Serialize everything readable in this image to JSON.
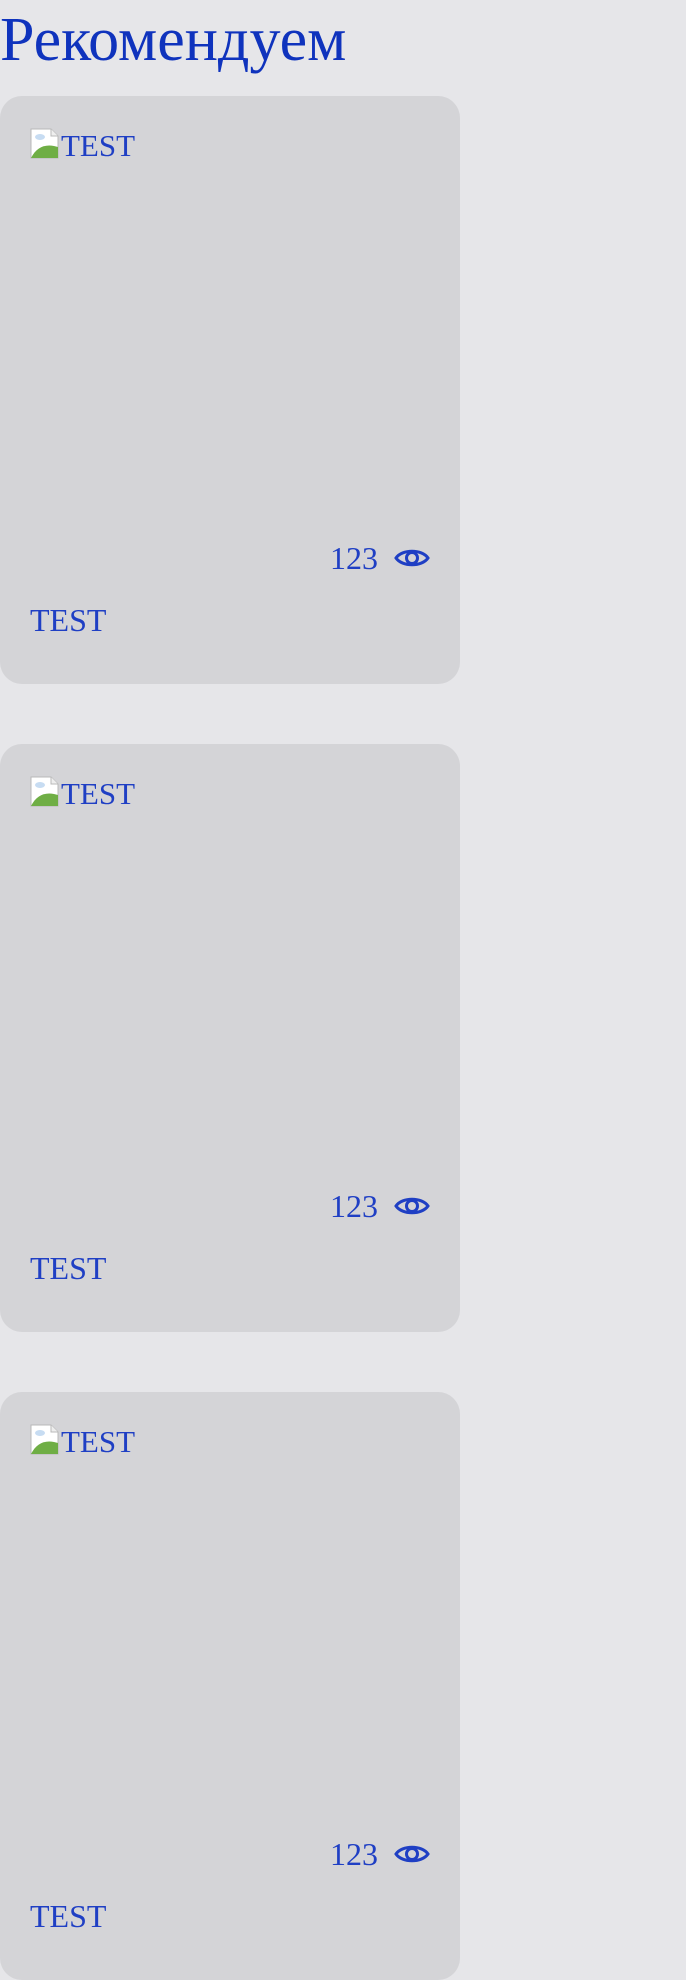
{
  "page": {
    "title": "Рекомендуем"
  },
  "cards": [
    {
      "image_alt": "TEST",
      "views": "123",
      "title": "TEST"
    },
    {
      "image_alt": "TEST",
      "views": "123",
      "title": "TEST"
    },
    {
      "image_alt": "TEST",
      "views": "123",
      "title": "TEST"
    }
  ],
  "icons": {
    "views": "eye-icon",
    "image": "broken-image-icon"
  },
  "colors": {
    "background": "#e6e6e9",
    "card": "#d4d4d7",
    "text": "#1f3fc4",
    "title": "#0f33bd"
  }
}
